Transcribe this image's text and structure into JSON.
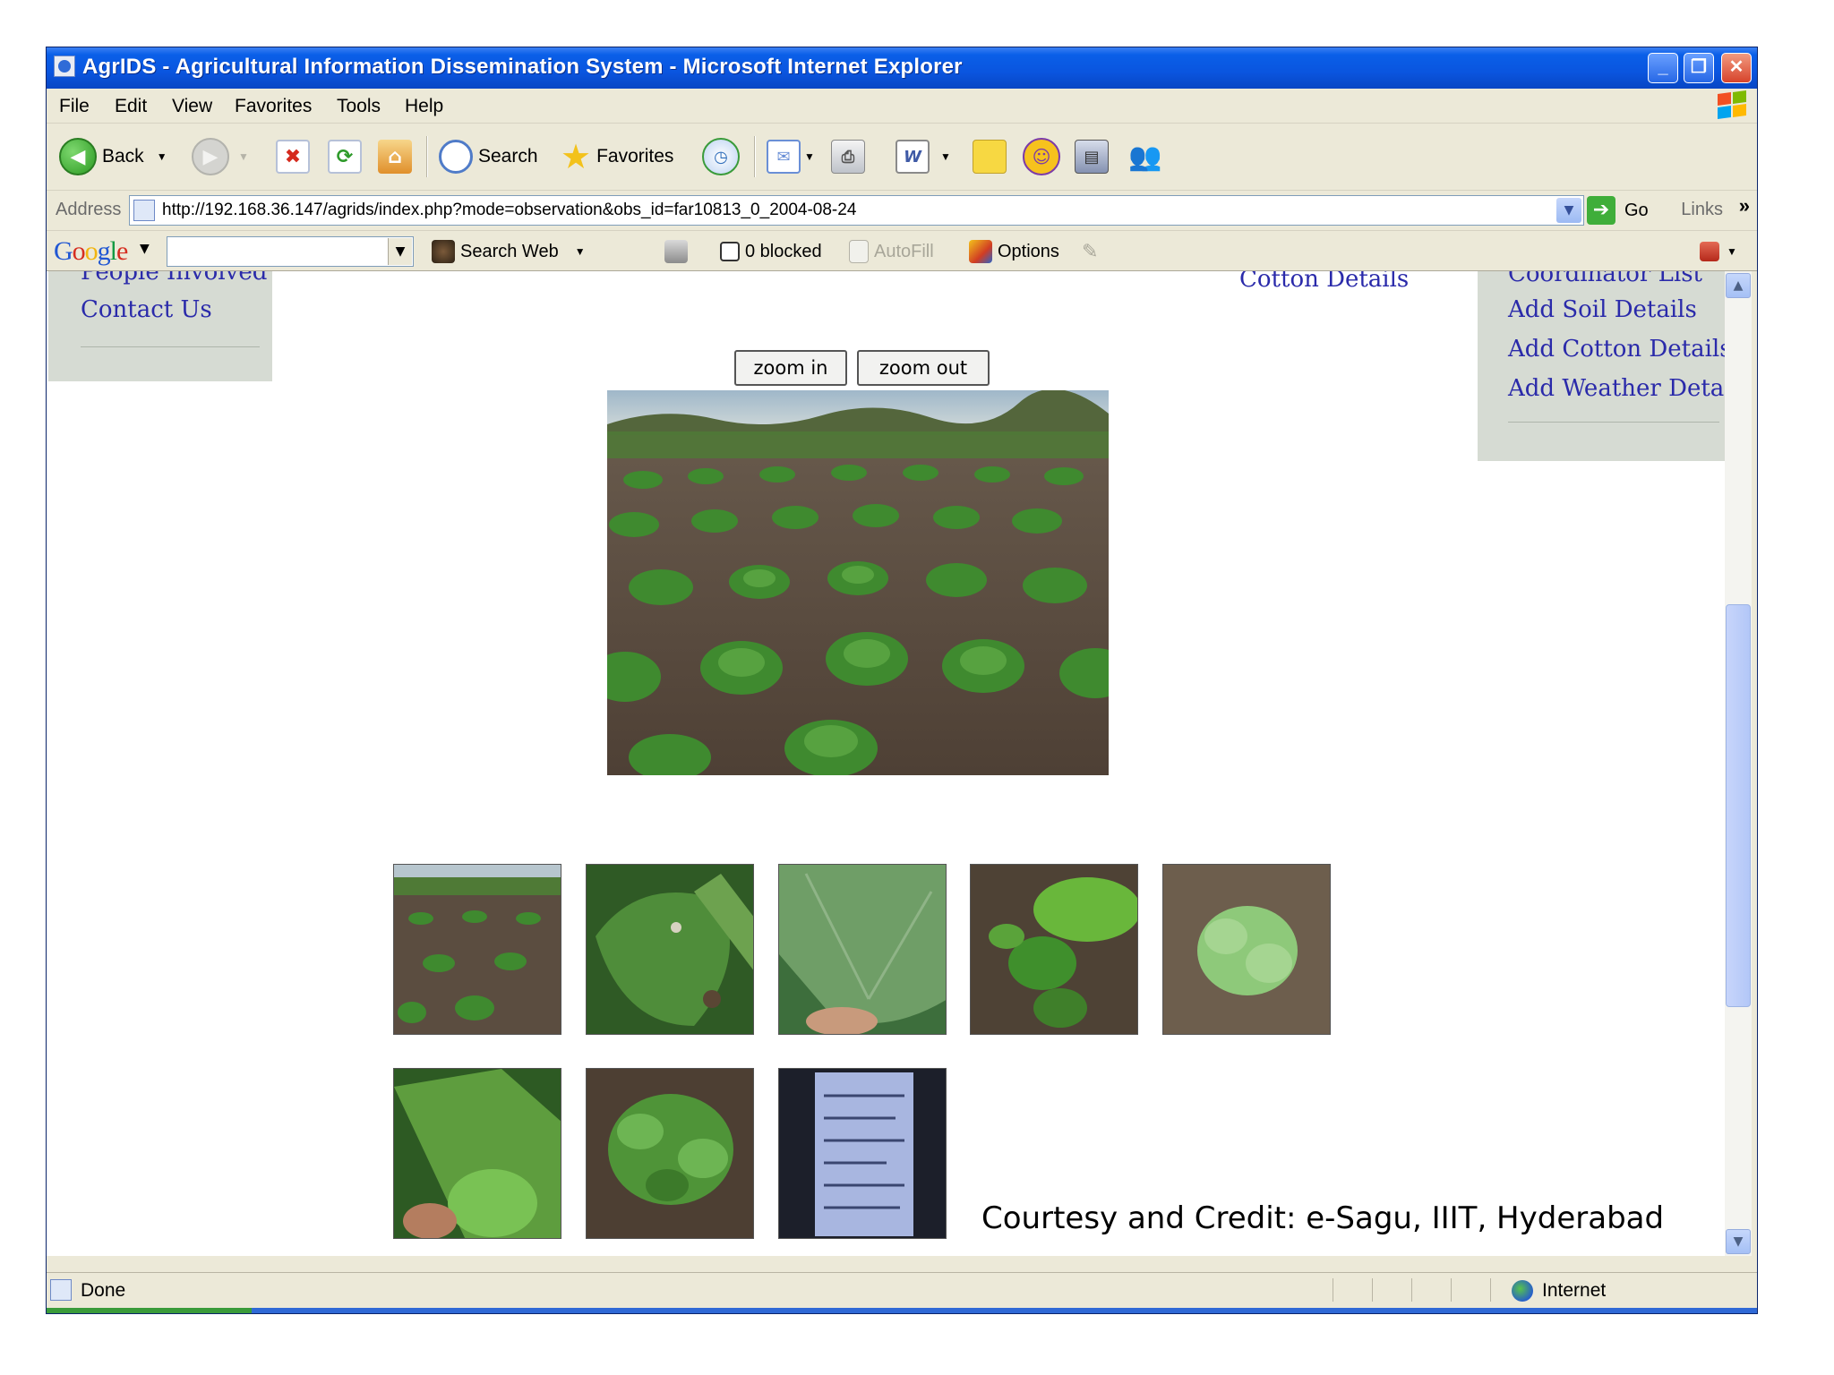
{
  "window": {
    "title": "AgrIDS - Agricultural Information Dissemination System - Microsoft Internet Explorer",
    "controls": [
      "_",
      "❐",
      "✕"
    ]
  },
  "menu": [
    "File",
    "Edit",
    "View",
    "Favorites",
    "Tools",
    "Help"
  ],
  "toolbar": {
    "back_label": "Back",
    "search_label": "Search",
    "favorites_label": "Favorites"
  },
  "address": {
    "label": "Address",
    "url": "http://192.168.36.147/agrids/index.php?mode=observation&obs_id=far10813_0_2004-08-24",
    "go_label": "Go",
    "links_label": "Links",
    "chevron": "»"
  },
  "google_toolbar": {
    "logo": [
      "G",
      "o",
      "o",
      "g",
      "l",
      "e"
    ],
    "search_web_label": "Search Web",
    "blocked_label": "0 blocked",
    "autofill_label": "AutoFill",
    "options_label": "Options"
  },
  "left_nav": {
    "partial_item": "People Involved",
    "contact_item": "Contact Us"
  },
  "center_nav": {
    "cotton_details": "Cotton Details"
  },
  "right_nav": {
    "partial_item": "Coordinator List",
    "items": [
      "Add Soil Details",
      "Add Cotton Details",
      "Add Weather Details"
    ]
  },
  "zoom": {
    "zoom_in": "zoom in",
    "zoom_out": "zoom out"
  },
  "photos": {
    "main": "cotton-field-rows",
    "thumbnails": [
      "cotton-field-rows",
      "cotton-leaf-damage",
      "cotton-leaf-closeup",
      "young-cotton-plant",
      "cotton-plant-pale",
      "leaf-in-hand",
      "cotton-plant-dense",
      "observation-card"
    ]
  },
  "credit": "Courtesy and Credit: e-Sagu, IIIT, Hyderabad",
  "status": {
    "text": "Done",
    "zone": "Internet"
  },
  "colors": {
    "title_bar": "#0a55df",
    "nav_panel": "#d6dbd3",
    "link": "#2a2aaa",
    "chrome": "#ece9d8"
  }
}
